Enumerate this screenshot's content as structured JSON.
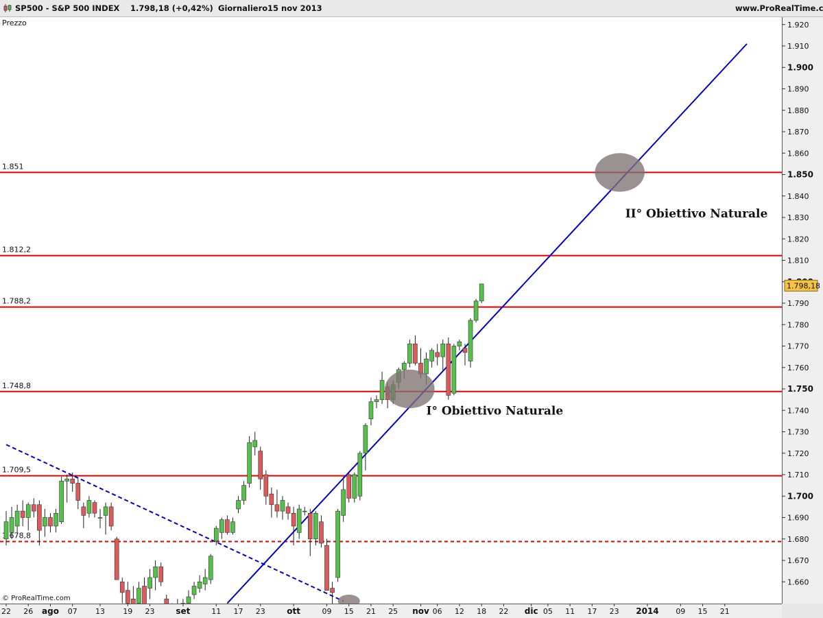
{
  "header": {
    "symbol": "SP500 - S&P 500 INDEX",
    "price_info": "1.798,18 (+0,42%)",
    "period": "Giornaliero",
    "date": "15 nov 2013",
    "site": "www.ProRealTime.com"
  },
  "pane_label": "Prezzo",
  "copyright": "© ProRealTime.com",
  "chart_data": {
    "type": "candlestick",
    "title": "SP500 - S&P 500 INDEX",
    "ylabel": "Prezzo",
    "ylim": [
      1650,
      1923
    ],
    "y_scale": "linear",
    "last_price": 1798.18,
    "last_price_label": "1.798,18",
    "y_ticks": [
      {
        "value": 1660,
        "label": "1.660",
        "bold": false
      },
      {
        "value": 1670,
        "label": "1.670",
        "bold": false
      },
      {
        "value": 1680,
        "label": "1.680",
        "bold": false
      },
      {
        "value": 1690,
        "label": "1.690",
        "bold": false
      },
      {
        "value": 1700,
        "label": "1.700",
        "bold": true
      },
      {
        "value": 1710,
        "label": "1.710",
        "bold": false
      },
      {
        "value": 1720,
        "label": "1.720",
        "bold": false
      },
      {
        "value": 1730,
        "label": "1.730",
        "bold": false
      },
      {
        "value": 1740,
        "label": "1.740",
        "bold": false
      },
      {
        "value": 1750,
        "label": "1.750",
        "bold": true
      },
      {
        "value": 1760,
        "label": "1.760",
        "bold": false
      },
      {
        "value": 1770,
        "label": "1.770",
        "bold": false
      },
      {
        "value": 1780,
        "label": "1.780",
        "bold": false
      },
      {
        "value": 1790,
        "label": "1.790",
        "bold": false
      },
      {
        "value": 1800,
        "label": "1.800",
        "bold": true
      },
      {
        "value": 1810,
        "label": "1.810",
        "bold": false
      },
      {
        "value": 1820,
        "label": "1.820",
        "bold": false
      },
      {
        "value": 1830,
        "label": "1.830",
        "bold": false
      },
      {
        "value": 1840,
        "label": "1.840",
        "bold": false
      },
      {
        "value": 1850,
        "label": "1.850",
        "bold": true
      },
      {
        "value": 1860,
        "label": "1.860",
        "bold": false
      },
      {
        "value": 1870,
        "label": "1.870",
        "bold": false
      },
      {
        "value": 1880,
        "label": "1.880",
        "bold": false
      },
      {
        "value": 1890,
        "label": "1.890",
        "bold": false
      },
      {
        "value": 1900,
        "label": "1.900",
        "bold": true
      },
      {
        "value": 1910,
        "label": "1.910",
        "bold": false
      },
      {
        "value": 1920,
        "label": "1.920",
        "bold": false
      }
    ],
    "x_ticks": [
      {
        "i": 0,
        "label": "22",
        "bold": false
      },
      {
        "i": 4,
        "label": "26",
        "bold": false
      },
      {
        "i": 8,
        "label": "ago",
        "bold": true
      },
      {
        "i": 12,
        "label": "07",
        "bold": false
      },
      {
        "i": 17,
        "label": "13",
        "bold": false
      },
      {
        "i": 22,
        "label": "19",
        "bold": false
      },
      {
        "i": 26,
        "label": "23",
        "bold": false
      },
      {
        "i": 32,
        "label": "set",
        "bold": true
      },
      {
        "i": 38,
        "label": "11",
        "bold": false
      },
      {
        "i": 42,
        "label": "17",
        "bold": false
      },
      {
        "i": 46,
        "label": "23",
        "bold": false
      },
      {
        "i": 52,
        "label": "ott",
        "bold": true
      },
      {
        "i": 58,
        "label": "09",
        "bold": false
      },
      {
        "i": 62,
        "label": "15",
        "bold": false
      },
      {
        "i": 66,
        "label": "21",
        "bold": false
      },
      {
        "i": 70,
        "label": "25",
        "bold": false
      },
      {
        "i": 75,
        "label": "nov",
        "bold": true
      },
      {
        "i": 78,
        "label": "06",
        "bold": false
      },
      {
        "i": 82,
        "label": "12",
        "bold": false
      },
      {
        "i": 86,
        "label": "18",
        "bold": false
      },
      {
        "i": 90,
        "label": "22",
        "bold": false
      },
      {
        "i": 95,
        "label": "dic",
        "bold": true
      },
      {
        "i": 98,
        "label": "05",
        "bold": false
      },
      {
        "i": 102,
        "label": "11",
        "bold": false
      },
      {
        "i": 106,
        "label": "17",
        "bold": false
      },
      {
        "i": 110,
        "label": "23",
        "bold": false
      },
      {
        "i": 116,
        "label": "2014",
        "bold": true
      },
      {
        "i": 122,
        "label": "09",
        "bold": false
      },
      {
        "i": 126,
        "label": "15",
        "bold": false
      },
      {
        "i": 130,
        "label": "21",
        "bold": false
      }
    ],
    "candles": [
      {
        "i": 0,
        "o": 1680,
        "h": 1693,
        "l": 1677,
        "c": 1688
      },
      {
        "i": 1,
        "o": 1683,
        "h": 1695,
        "l": 1680,
        "c": 1690
      },
      {
        "i": 2,
        "o": 1686,
        "h": 1696,
        "l": 1683,
        "c": 1693
      },
      {
        "i": 3,
        "o": 1693,
        "h": 1698,
        "l": 1686,
        "c": 1690
      },
      {
        "i": 4,
        "o": 1690,
        "h": 1697,
        "l": 1684,
        "c": 1696
      },
      {
        "i": 5,
        "o": 1696,
        "h": 1699,
        "l": 1690,
        "c": 1693
      },
      {
        "i": 6,
        "o": 1696,
        "h": 1698,
        "l": 1677,
        "c": 1684
      },
      {
        "i": 7,
        "o": 1686,
        "h": 1694,
        "l": 1681,
        "c": 1690
      },
      {
        "i": 8,
        "o": 1690,
        "h": 1692,
        "l": 1683,
        "c": 1686
      },
      {
        "i": 9,
        "o": 1686,
        "h": 1694,
        "l": 1683,
        "c": 1692
      },
      {
        "i": 10,
        "o": 1688,
        "h": 1709,
        "l": 1687,
        "c": 1707
      },
      {
        "i": 11,
        "o": 1707,
        "h": 1710,
        "l": 1697,
        "c": 1708
      },
      {
        "i": 12,
        "o": 1708,
        "h": 1711,
        "l": 1702,
        "c": 1706
      },
      {
        "i": 13,
        "o": 1706,
        "h": 1708,
        "l": 1694,
        "c": 1698
      },
      {
        "i": 14,
        "o": 1695,
        "h": 1697,
        "l": 1685,
        "c": 1691
      },
      {
        "i": 15,
        "o": 1692,
        "h": 1700,
        "l": 1690,
        "c": 1698
      },
      {
        "i": 16,
        "o": 1697,
        "h": 1698,
        "l": 1690,
        "c": 1692
      },
      {
        "i": 17,
        "o": 1690,
        "h": 1694,
        "l": 1685,
        "c": 1690
      },
      {
        "i": 18,
        "o": 1691,
        "h": 1697,
        "l": 1682,
        "c": 1695
      },
      {
        "i": 19,
        "o": 1695,
        "h": 1697,
        "l": 1684,
        "c": 1686
      },
      {
        "i": 20,
        "o": 1680,
        "h": 1681,
        "l": 1661,
        "c": 1661
      },
      {
        "i": 21,
        "o": 1660,
        "h": 1662,
        "l": 1650,
        "c": 1655
      },
      {
        "i": 22,
        "o": 1656,
        "h": 1660,
        "l": 1648,
        "c": 1650
      },
      {
        "i": 23,
        "o": 1652,
        "h": 1658,
        "l": 1645,
        "c": 1648
      },
      {
        "i": 24,
        "o": 1650,
        "h": 1660,
        "l": 1645,
        "c": 1657
      },
      {
        "i": 25,
        "o": 1658,
        "h": 1662,
        "l": 1645,
        "c": 1648
      },
      {
        "i": 26,
        "o": 1657,
        "h": 1666,
        "l": 1652,
        "c": 1662
      },
      {
        "i": 27,
        "o": 1662,
        "h": 1670,
        "l": 1656,
        "c": 1667
      },
      {
        "i": 28,
        "o": 1667,
        "h": 1669,
        "l": 1658,
        "c": 1660
      },
      {
        "i": 29,
        "o": 1652,
        "h": 1654,
        "l": 1640,
        "c": 1644
      },
      {
        "i": 30,
        "o": 1645,
        "h": 1650,
        "l": 1640,
        "c": 1648
      },
      {
        "i": 31,
        "o": 1648,
        "h": 1652,
        "l": 1642,
        "c": 1646
      },
      {
        "i": 32,
        "o": 1646,
        "h": 1652,
        "l": 1643,
        "c": 1650
      },
      {
        "i": 33,
        "o": 1650,
        "h": 1656,
        "l": 1647,
        "c": 1653
      },
      {
        "i": 34,
        "o": 1654,
        "h": 1660,
        "l": 1652,
        "c": 1658
      },
      {
        "i": 35,
        "o": 1657,
        "h": 1663,
        "l": 1655,
        "c": 1660
      },
      {
        "i": 36,
        "o": 1659,
        "h": 1666,
        "l": 1656,
        "c": 1662
      },
      {
        "i": 37,
        "o": 1661,
        "h": 1673,
        "l": 1659,
        "c": 1672
      },
      {
        "i": 38,
        "o": 1679,
        "h": 1686,
        "l": 1677,
        "c": 1685
      },
      {
        "i": 39,
        "o": 1683,
        "h": 1690,
        "l": 1680,
        "c": 1689
      },
      {
        "i": 40,
        "o": 1689,
        "h": 1691,
        "l": 1682,
        "c": 1683
      },
      {
        "i": 41,
        "o": 1683,
        "h": 1690,
        "l": 1682,
        "c": 1688
      },
      {
        "i": 42,
        "o": 1694,
        "h": 1700,
        "l": 1692,
        "c": 1698
      },
      {
        "i": 43,
        "o": 1698,
        "h": 1707,
        "l": 1696,
        "c": 1705
      },
      {
        "i": 44,
        "o": 1706,
        "h": 1728,
        "l": 1704,
        "c": 1725
      },
      {
        "i": 45,
        "o": 1723,
        "h": 1730,
        "l": 1719,
        "c": 1726
      },
      {
        "i": 46,
        "o": 1721,
        "h": 1723,
        "l": 1703,
        "c": 1708
      },
      {
        "i": 47,
        "o": 1710,
        "h": 1712,
        "l": 1696,
        "c": 1700
      },
      {
        "i": 48,
        "o": 1701,
        "h": 1704,
        "l": 1690,
        "c": 1696
      },
      {
        "i": 49,
        "o": 1696,
        "h": 1703,
        "l": 1690,
        "c": 1693
      },
      {
        "i": 50,
        "o": 1693,
        "h": 1700,
        "l": 1689,
        "c": 1698
      },
      {
        "i": 51,
        "o": 1695,
        "h": 1697,
        "l": 1689,
        "c": 1692
      },
      {
        "i": 52,
        "o": 1692,
        "h": 1695,
        "l": 1677,
        "c": 1686
      },
      {
        "i": 53,
        "o": 1683,
        "h": 1696,
        "l": 1680,
        "c": 1694
      },
      {
        "i": 54,
        "o": 1693,
        "h": 1695,
        "l": 1691,
        "c": 1693
      },
      {
        "i": 55,
        "o": 1692,
        "h": 1694,
        "l": 1672,
        "c": 1680
      },
      {
        "i": 56,
        "o": 1680,
        "h": 1693,
        "l": 1677,
        "c": 1692
      },
      {
        "i": 57,
        "o": 1688,
        "h": 1691,
        "l": 1676,
        "c": 1678
      },
      {
        "i": 58,
        "o": 1677,
        "h": 1680,
        "l": 1656,
        "c": 1656
      },
      {
        "i": 59,
        "o": 1657,
        "h": 1660,
        "l": 1647,
        "c": 1655
      },
      {
        "i": 60,
        "o": 1662,
        "h": 1694,
        "l": 1660,
        "c": 1693
      },
      {
        "i": 61,
        "o": 1691,
        "h": 1709,
        "l": 1688,
        "c": 1703
      },
      {
        "i": 62,
        "o": 1710,
        "h": 1711,
        "l": 1697,
        "c": 1699
      },
      {
        "i": 63,
        "o": 1699,
        "h": 1711,
        "l": 1697,
        "c": 1710
      },
      {
        "i": 64,
        "o": 1700,
        "h": 1721,
        "l": 1698,
        "c": 1720
      },
      {
        "i": 65,
        "o": 1720,
        "h": 1734,
        "l": 1712,
        "c": 1733
      },
      {
        "i": 66,
        "o": 1736,
        "h": 1746,
        "l": 1733,
        "c": 1744
      },
      {
        "i": 67,
        "o": 1744,
        "h": 1747,
        "l": 1741,
        "c": 1745
      },
      {
        "i": 68,
        "o": 1745,
        "h": 1758,
        "l": 1743,
        "c": 1754
      },
      {
        "i": 69,
        "o": 1751,
        "h": 1753,
        "l": 1741,
        "c": 1745
      },
      {
        "i": 70,
        "o": 1745,
        "h": 1754,
        "l": 1743,
        "c": 1752
      },
      {
        "i": 71,
        "o": 1753,
        "h": 1760,
        "l": 1750,
        "c": 1759
      },
      {
        "i": 72,
        "o": 1759,
        "h": 1763,
        "l": 1755,
        "c": 1762
      },
      {
        "i": 73,
        "o": 1762,
        "h": 1773,
        "l": 1760,
        "c": 1771
      },
      {
        "i": 74,
        "o": 1771,
        "h": 1775,
        "l": 1761,
        "c": 1762
      },
      {
        "i": 75,
        "o": 1762,
        "h": 1769,
        "l": 1755,
        "c": 1757
      },
      {
        "i": 76,
        "o": 1757,
        "h": 1767,
        "l": 1752,
        "c": 1764
      },
      {
        "i": 77,
        "o": 1763,
        "h": 1769,
        "l": 1760,
        "c": 1768
      },
      {
        "i": 78,
        "o": 1767,
        "h": 1771,
        "l": 1761,
        "c": 1765
      },
      {
        "i": 79,
        "o": 1765,
        "h": 1773,
        "l": 1758,
        "c": 1771
      },
      {
        "i": 80,
        "o": 1771,
        "h": 1774,
        "l": 1745,
        "c": 1747
      },
      {
        "i": 81,
        "o": 1748,
        "h": 1771,
        "l": 1747,
        "c": 1770
      },
      {
        "i": 82,
        "o": 1770,
        "h": 1773,
        "l": 1768,
        "c": 1772
      },
      {
        "i": 83,
        "o": 1769,
        "h": 1771,
        "l": 1761,
        "c": 1767
      },
      {
        "i": 84,
        "o": 1763,
        "h": 1783,
        "l": 1760,
        "c": 1782
      },
      {
        "i": 85,
        "o": 1782,
        "h": 1792,
        "l": 1781,
        "c": 1791
      },
      {
        "i": 86,
        "o": 1791,
        "h": 1799,
        "l": 1790,
        "c": 1799
      }
    ],
    "horizontal_levels": [
      {
        "value": 1851.0,
        "label": "1.851",
        "style": "solid"
      },
      {
        "value": 1812.2,
        "label": "1.812,2",
        "style": "solid"
      },
      {
        "value": 1788.2,
        "label": "1.788,2",
        "style": "solid"
      },
      {
        "value": 1748.8,
        "label": "1.748,8",
        "style": "solid"
      },
      {
        "value": 1709.5,
        "label": "1.709,5",
        "style": "solid"
      },
      {
        "value": 1678.8,
        "label": "1.678,8",
        "style": "dashed"
      }
    ],
    "trend_lines": [
      {
        "name": "rising",
        "style": "solid",
        "from": {
          "i": 40,
          "v": 1650
        },
        "to": {
          "i": 134,
          "v": 1911
        }
      },
      {
        "name": "falling",
        "style": "dashed",
        "from": {
          "i": 0,
          "v": 1724
        },
        "to": {
          "i": 61,
          "v": 1651
        }
      }
    ],
    "target_zones": [
      {
        "i": 73,
        "v": 1750,
        "rx_bars": 4.5,
        "ry_value": 9
      },
      {
        "i": 111,
        "v": 1851,
        "rx_bars": 4.5,
        "ry_value": 9
      },
      {
        "i": 62,
        "v": 1651,
        "rx_bars": 2,
        "ry_value": 3
      }
    ],
    "annotations": [
      {
        "text": "I° Obiettivo Naturale",
        "i": 76,
        "v": 1738
      },
      {
        "text": "II° Obiettivo Naturale",
        "i": 112,
        "v": 1830
      }
    ],
    "colors": {
      "up": "#55c04a",
      "down": "#dd5a5a",
      "wick": "#222222",
      "level": "#e00000",
      "trend": "#0000cc",
      "zone": "#7f7272",
      "last_price_bg": "#f5c242"
    }
  }
}
